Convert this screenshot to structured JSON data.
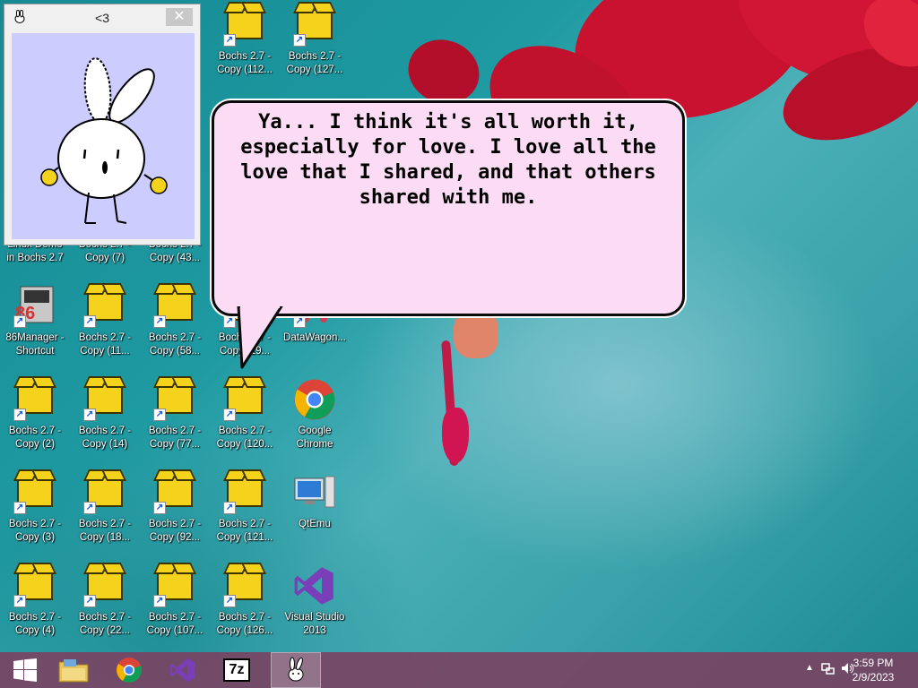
{
  "pet_window": {
    "title": "<3",
    "close_glyph": "✕"
  },
  "speech_bubble": {
    "text": "Ya... I think it's all worth it, especially for love. I love all the love that I shared, and that others shared with me."
  },
  "desktop_icons": [
    {
      "id": "bochs-112",
      "label": "Bochs 2.7 -\nCopy (112...",
      "icon": "box-icon"
    },
    {
      "id": "bochs-127",
      "label": "Bochs 2.7 -\nCopy (127...",
      "icon": "box-icon"
    },
    {
      "id": "linux-demo",
      "label": "Linux Demo\nin Bochs 2.7",
      "icon": "box-icon"
    },
    {
      "id": "bochs-7",
      "label": "Bochs 2.7 -\nCopy (7)",
      "icon": "box-icon"
    },
    {
      "id": "bochs-43",
      "label": "Bochs 2.7 -\nCopy (43...",
      "icon": "box-icon"
    },
    {
      "id": "86manager",
      "label": "86Manager -\nShortcut",
      "icon": "86manager-icon"
    },
    {
      "id": "bochs-11",
      "label": "Bochs 2.7 -\nCopy (11...",
      "icon": "box-icon"
    },
    {
      "id": "bochs-58",
      "label": "Bochs 2.7 -\nCopy (58...",
      "icon": "box-icon"
    },
    {
      "id": "bochs-19",
      "label": "Bochs 2.7 -\nCopy (19...",
      "icon": "box-icon"
    },
    {
      "id": "datawagon",
      "label": "DataWagon...",
      "icon": "datawagon-icon"
    },
    {
      "id": "bochs-2",
      "label": "Bochs 2.7 -\nCopy (2)",
      "icon": "box-icon"
    },
    {
      "id": "bochs-14",
      "label": "Bochs 2.7 -\nCopy (14)",
      "icon": "box-icon"
    },
    {
      "id": "bochs-77",
      "label": "Bochs 2.7 -\nCopy (77...",
      "icon": "box-icon"
    },
    {
      "id": "bochs-120",
      "label": "Bochs 2.7 -\nCopy (120...",
      "icon": "box-icon"
    },
    {
      "id": "chrome",
      "label": "Google\nChrome",
      "icon": "chrome-icon"
    },
    {
      "id": "bochs-3",
      "label": "Bochs 2.7 -\nCopy (3)",
      "icon": "box-icon"
    },
    {
      "id": "bochs-18",
      "label": "Bochs 2.7 -\nCopy (18...",
      "icon": "box-icon"
    },
    {
      "id": "bochs-92",
      "label": "Bochs 2.7 -\nCopy (92...",
      "icon": "box-icon"
    },
    {
      "id": "bochs-121",
      "label": "Bochs 2.7 -\nCopy (121...",
      "icon": "box-icon"
    },
    {
      "id": "qtemu",
      "label": "QtEmu",
      "icon": "qtemu-icon"
    },
    {
      "id": "bochs-4",
      "label": "Bochs 2.7 -\nCopy (4)",
      "icon": "box-icon"
    },
    {
      "id": "bochs-22",
      "label": "Bochs 2.7 -\nCopy (22...",
      "icon": "box-icon"
    },
    {
      "id": "bochs-107",
      "label": "Bochs 2.7 -\nCopy (107...",
      "icon": "box-icon"
    },
    {
      "id": "bochs-126",
      "label": "Bochs 2.7 -\nCopy (126...",
      "icon": "box-icon"
    },
    {
      "id": "vs2013",
      "label": "Visual Studio\n2013",
      "icon": "visual-studio-icon"
    }
  ],
  "taskbar": {
    "buttons": [
      {
        "name": "start",
        "icon": "windows-logo-icon"
      },
      {
        "name": "file-explorer",
        "icon": "folder-icon"
      },
      {
        "name": "chrome",
        "icon": "chrome-icon"
      },
      {
        "name": "visual-studio",
        "icon": "visual-studio-icon"
      },
      {
        "name": "7zip",
        "icon": "7zip-icon",
        "text": "7z"
      },
      {
        "name": "bunny-pet",
        "icon": "bunny-icon"
      }
    ],
    "clock": {
      "time": "3:59 PM",
      "date": "2/9/2023"
    }
  },
  "colors": {
    "taskbar": "#7b4060",
    "bubble_fill": "#fbdcf4",
    "pet_bg": "#ccccff",
    "box_yellow": "#f5d21b",
    "wallpaper": "#1e9aa2"
  }
}
